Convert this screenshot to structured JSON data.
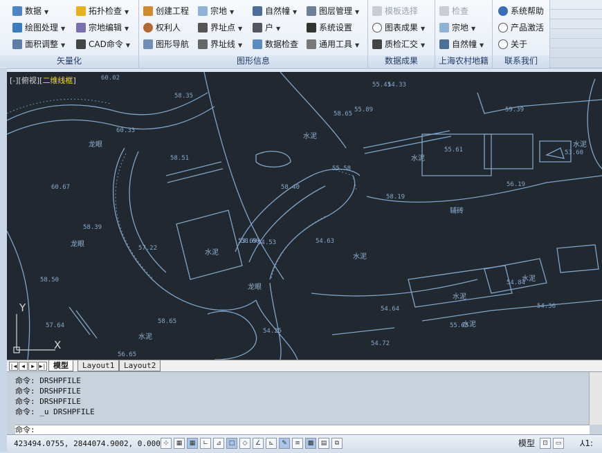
{
  "ribbon": {
    "groups": [
      {
        "title": "矢量化",
        "items": [
          "数据",
          "绘图处理",
          "面积调整",
          "拓扑检查",
          "宗地编辑",
          "CAD命令"
        ]
      },
      {
        "title": "图形信息",
        "items": [
          "创建工程",
          "权利人",
          "图形导航",
          "宗地",
          "界址点",
          "界址线",
          "自然幢",
          "户",
          "数据检查",
          "图层管理",
          "系统设置",
          "通用工具"
        ]
      },
      {
        "title": "数据成果",
        "items": [
          "模板选择",
          "图表成果",
          "质检汇交"
        ]
      },
      {
        "title": "上海农村地籍",
        "items": [
          "检查",
          "宗地",
          "自然幢"
        ]
      },
      {
        "title": "联系我们",
        "items": [
          "系统帮助",
          "产品激活",
          "关于"
        ]
      }
    ]
  },
  "viewport": {
    "label_prefix": "[-][俯视][",
    "label_mode": "二维线框",
    "label_suffix": "]",
    "axis_x": "X",
    "axis_y": "Y",
    "annotations": [
      "58.35",
      "58.51",
      "60.02",
      "60.33",
      "58.50",
      "60.67",
      "58.39",
      "57.22",
      "58.60",
      "57.64",
      "58.65",
      "56.65",
      "58.40",
      "55.58",
      "55.61",
      "55.89",
      "59.39",
      "56.19",
      "55.63",
      "54.84",
      "54.64",
      "54.63",
      "54.36",
      "54.25",
      "54.72",
      "53.69",
      "53.60",
      "58.19",
      "55.41",
      "58.65",
      "54.53",
      "54.33"
    ],
    "text_labels": [
      "水泥",
      "龙眼",
      "辅砖",
      "水泥",
      "水泥",
      "龙眼",
      "水泥",
      "水泥",
      "水泥",
      "水泥",
      "水泥",
      "龙眼",
      "水泥"
    ]
  },
  "tabs": {
    "model": "模型",
    "layout1": "Layout1",
    "layout2": "Layout2"
  },
  "command": {
    "history": [
      "命令: DRSHPFILE",
      "命令: DRSHPFILE",
      "命令: DRSHPFILE",
      "命令: _u DRSHPFILE"
    ],
    "prompt": "命令:"
  },
  "status": {
    "coords": "423494.0755, 2844074.9002, 0.0000",
    "model": "模型",
    "scale": "1:"
  },
  "colors": {
    "canvas_bg": "#212830",
    "linework": "#7fa6cc",
    "ribbon_text": "#1e3966"
  }
}
